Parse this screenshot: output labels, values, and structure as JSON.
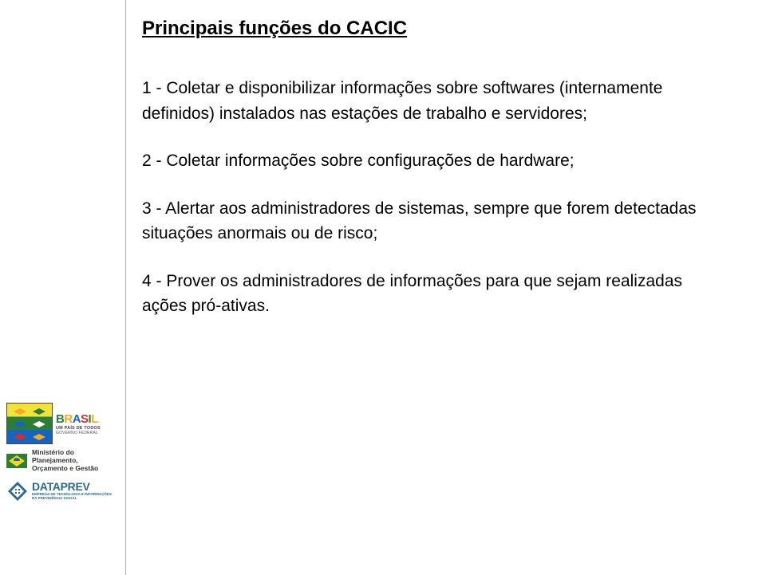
{
  "title": "Principais funções do CACIC",
  "items": [
    "1 - Coletar e disponibilizar informações sobre softwares (internamente definidos) instalados nas estações de trabalho e servidores;",
    "2 - Coletar informações sobre configurações de hardware;",
    "3 - Alertar aos administradores de sistemas, sempre que forem detectadas situações anormais ou de risco;",
    "4 - Prover os administradores de informações para que sejam realizadas ações pró-ativas."
  ],
  "logos": {
    "brasil": {
      "word_letters": [
        "B",
        "R",
        "A",
        "S",
        "I",
        "L"
      ],
      "tagline": "UM PAÍS DE TODOS",
      "gov": "GOVERNO FEDERAL"
    },
    "ministerio": {
      "line1": "Ministério do",
      "line2": "Planejamento,",
      "line3": "Orçamento e Gestão"
    },
    "dataprev": {
      "name": "DATAPREV",
      "sub1": "EMPRESA DE TECNOLOGIA E INFORMAÇÕES",
      "sub2": "DA PREVIDÊNCIA SOCIAL"
    }
  }
}
